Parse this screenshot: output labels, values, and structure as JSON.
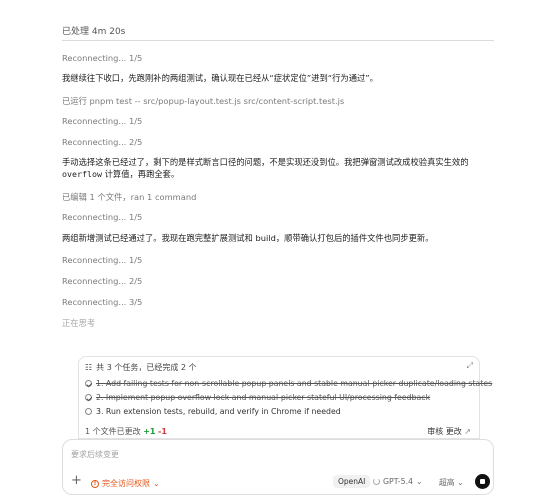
{
  "header": {
    "status": "已处理 4m 20s"
  },
  "log": [
    {
      "text": "Reconnecting... 1/5",
      "style": "muted"
    },
    {
      "text": "我继续往下收口，先跑刚补的两组测试，确认现在已经从“症状定位”进到“行为通过”。",
      "style": "body"
    },
    {
      "text": "已运行 pnpm test -- src/popup-layout.test.js src/content-script.test.js",
      "style": "muted"
    },
    {
      "text": "Reconnecting... 1/5",
      "style": "muted"
    },
    {
      "text": "Reconnecting... 2/5",
      "style": "muted"
    },
    {
      "text_a": "手动选择这条已经过了，剩下的是样式断言口径的问题，不是实现还没到位。我把弹窗测试改成校验真实生效的 ",
      "code": "overflow",
      "text_b": " 计算值，再跑全套。",
      "style": "body-code"
    },
    {
      "text": "已编辑 1 个文件，ran 1 command",
      "style": "muted"
    },
    {
      "text": "Reconnecting... 1/5",
      "style": "muted"
    },
    {
      "text": "两组新增测试已经通过了。我现在跑完整扩展测试和 build，顺带确认打包后的插件文件也同步更新。",
      "style": "body"
    },
    {
      "text": "Reconnecting... 1/5",
      "style": "muted"
    },
    {
      "text": "Reconnecting... 2/5",
      "style": "muted"
    },
    {
      "text": "Reconnecting... 3/5",
      "style": "muted"
    },
    {
      "text": "正在思考",
      "style": "faint"
    }
  ],
  "tasks": {
    "summary": "共 3 个任务，已经完成 2 个",
    "items": [
      {
        "text": "1.  Add failing tests for non-scrollable popup panels and stable manual-picker duplicate/loading states",
        "done": true
      },
      {
        "text": "2.  Implement popup overflow lock and manual-picker stateful UI/processing feedback",
        "done": true
      },
      {
        "text": "3.  Run extension tests, rebuild, and verify in Chrome if needed",
        "done": false
      }
    ],
    "files_changed": "1 个文件已更改",
    "added": "+1",
    "removed": "-1",
    "review_label": "审核 更改"
  },
  "composer": {
    "placeholder": "要求后续变更",
    "access_label": "完全访问权限",
    "provider": "OpenAI",
    "model": "GPT-5.4",
    "effort": "超高"
  },
  "icons": {
    "tasks": "list-check-icon",
    "expand": "expand-icon",
    "add": "plus-icon",
    "warning": "warning-icon",
    "stop": "stop-icon"
  },
  "colors": {
    "accent_warning": "#e0581b",
    "added": "#1a9b3a",
    "removed": "#d23b3b"
  }
}
